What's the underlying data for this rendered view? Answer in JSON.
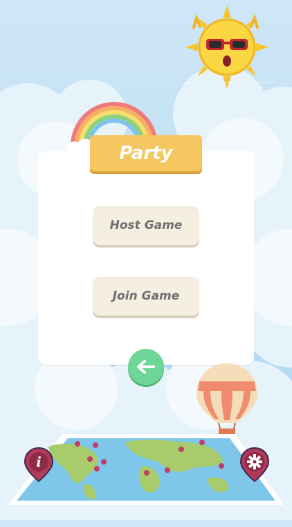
{
  "header": {
    "title": "Party"
  },
  "menu": {
    "host_label": "Host Game",
    "join_label": "Join Game"
  },
  "controls": {
    "back_icon": "arrow-left-icon",
    "info_icon": "info-icon",
    "settings_icon": "gear-icon",
    "info_glyph": "i"
  },
  "colors": {
    "title_tab": "#f6c760",
    "menu_button": "#f5efe1",
    "back_button": "#6fd69a",
    "map_pin": "#b23a5c"
  }
}
